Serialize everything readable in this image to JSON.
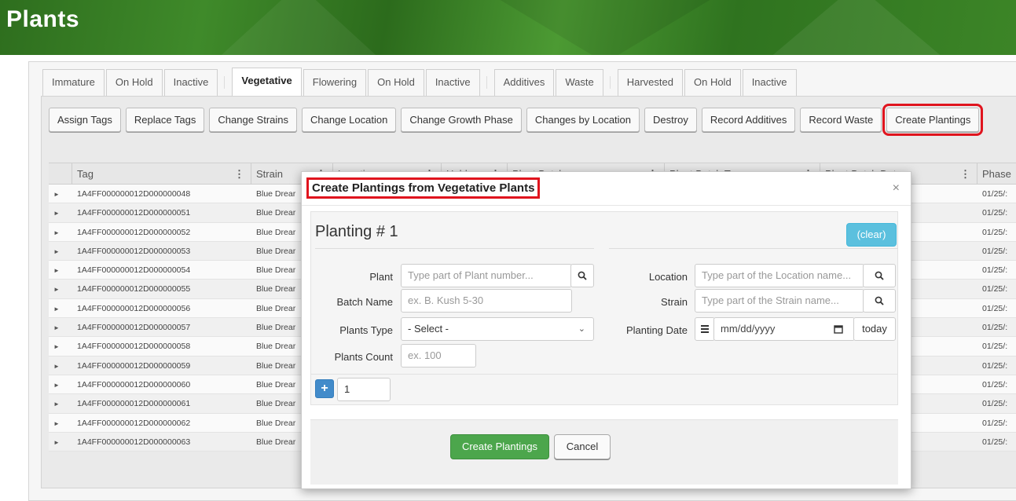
{
  "header": {
    "title": "Plants"
  },
  "tabs": [
    {
      "label": "Immature"
    },
    {
      "label": "On Hold"
    },
    {
      "label": "Inactive"
    },
    {
      "label": "Vegetative"
    },
    {
      "label": "Flowering"
    },
    {
      "label": "On Hold"
    },
    {
      "label": "Inactive"
    },
    {
      "label": "Additives"
    },
    {
      "label": "Waste"
    },
    {
      "label": "Harvested"
    },
    {
      "label": "On Hold"
    },
    {
      "label": "Inactive"
    }
  ],
  "actions": [
    {
      "label": "Assign Tags"
    },
    {
      "label": "Replace Tags"
    },
    {
      "label": "Change Strains"
    },
    {
      "label": "Change Location"
    },
    {
      "label": "Change Growth Phase"
    },
    {
      "label": "Changes by Location"
    },
    {
      "label": "Destroy"
    },
    {
      "label": "Record Additives"
    },
    {
      "label": "Record Waste"
    },
    {
      "label": "Create Plantings"
    }
  ],
  "grid": {
    "columns": [
      "Tag",
      "Strain",
      "Location",
      "Hold",
      "Plant Batch",
      "Plant Batch Type",
      "Plant Batch Date",
      "Phase"
    ],
    "rows": [
      {
        "tag": "1A4FF000000012D000000048",
        "strain": "Blue Drear",
        "phase": "01/25/:"
      },
      {
        "tag": "1A4FF000000012D000000051",
        "strain": "Blue Drear",
        "phase": "01/25/:"
      },
      {
        "tag": "1A4FF000000012D000000052",
        "strain": "Blue Drear",
        "phase": "01/25/:"
      },
      {
        "tag": "1A4FF000000012D000000053",
        "strain": "Blue Drear",
        "phase": "01/25/:"
      },
      {
        "tag": "1A4FF000000012D000000054",
        "strain": "Blue Drear",
        "phase": "01/25/:"
      },
      {
        "tag": "1A4FF000000012D000000055",
        "strain": "Blue Drear",
        "phase": "01/25/:"
      },
      {
        "tag": "1A4FF000000012D000000056",
        "strain": "Blue Drear",
        "phase": "01/25/:"
      },
      {
        "tag": "1A4FF000000012D000000057",
        "strain": "Blue Drear",
        "phase": "01/25/:"
      },
      {
        "tag": "1A4FF000000012D000000058",
        "strain": "Blue Drear",
        "phase": "01/25/:"
      },
      {
        "tag": "1A4FF000000012D000000059",
        "strain": "Blue Drear",
        "phase": "01/25/:"
      },
      {
        "tag": "1A4FF000000012D000000060",
        "strain": "Blue Drear",
        "phase": "01/25/:"
      },
      {
        "tag": "1A4FF000000012D000000061",
        "strain": "Blue Drear",
        "phase": "01/25/:"
      },
      {
        "tag": "1A4FF000000012D000000062",
        "strain": "Blue Drear",
        "phase": "01/25/:"
      },
      {
        "tag": "1A4FF000000012D000000063",
        "strain": "Blue Drear",
        "phase": "01/25/:"
      }
    ]
  },
  "modal": {
    "title": "Create Plantings from Vegetative Plants",
    "close": "×",
    "planting_title": "Planting # 1",
    "clear_label": "(clear)",
    "plant": {
      "label": "Plant",
      "placeholder": "Type part of Plant number..."
    },
    "batch_name": {
      "label": "Batch Name",
      "placeholder": "ex. B. Kush 5-30"
    },
    "plants_type": {
      "label": "Plants Type",
      "value": "- Select -"
    },
    "plants_count": {
      "label": "Plants Count",
      "placeholder": "ex. 100"
    },
    "location": {
      "label": "Location",
      "placeholder": "Type part of the Location name..."
    },
    "strain": {
      "label": "Strain",
      "placeholder": "Type part of the Strain name..."
    },
    "planting_date": {
      "label": "Planting Date",
      "placeholder": "mm/dd/yyyy",
      "today_label": "today"
    },
    "add_count": "1",
    "create_label": "Create Plantings",
    "cancel_label": "Cancel"
  },
  "colors": {
    "highlight": "#e0141e",
    "create_button": "#4ca64c",
    "clear_button": "#5bc0de",
    "add_button": "#428bca"
  }
}
